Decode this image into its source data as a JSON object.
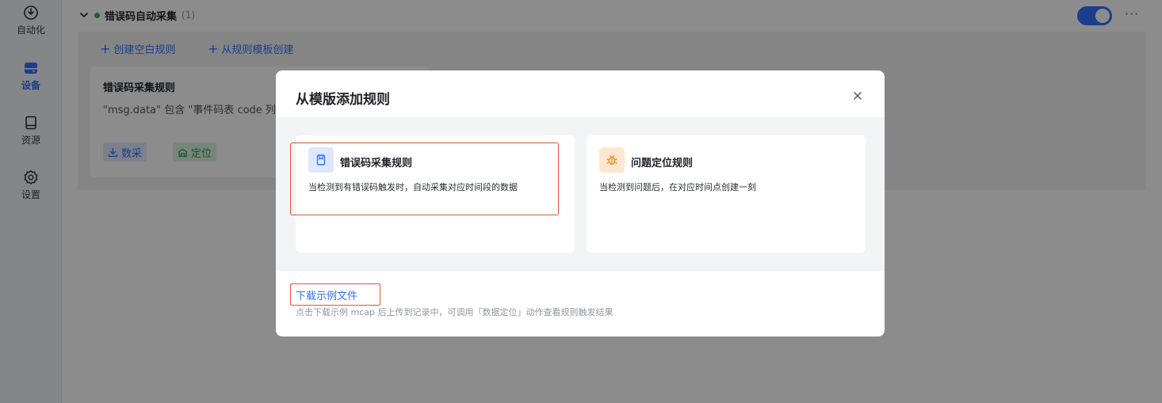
{
  "sidebar": {
    "items": [
      {
        "label": "自动化",
        "icon": "automation-icon",
        "active": false
      },
      {
        "label": "设备",
        "icon": "device-icon",
        "active": true
      },
      {
        "label": "资源",
        "icon": "resource-icon",
        "active": false
      },
      {
        "label": "设置",
        "icon": "settings-icon",
        "active": false
      }
    ]
  },
  "group": {
    "title": "错误码自动采集",
    "count": "(1)",
    "enabled": true,
    "more": "···"
  },
  "toolbar": {
    "create_blank": "创建空白规则",
    "create_from_template": "从规则模板创建"
  },
  "rule_card": {
    "title": "错误码采集规则",
    "description": "\"msg.data\" 包含 \"事件码表 code 列",
    "tags": [
      "数采",
      "定位"
    ]
  },
  "modal": {
    "title": "从模版添加规则",
    "templates": [
      {
        "title": "错误码采集规则",
        "description": "当检测到有错误码触发时，自动采集对应时间段的数据",
        "icon": "bookmark-icon",
        "accent": "#3370ff"
      },
      {
        "title": "问题定位规则",
        "description": "当检测到问题后，在对应时间点创建一刻",
        "icon": "bug-icon",
        "accent": "#f08a24"
      }
    ],
    "download_link": "下载示例文件",
    "download_hint": "点击下载示例 mcap 后上传到记录中，可调用「数据定位」动作查看规则触发结果"
  },
  "colors": {
    "accent": "#3370ff",
    "status_green": "#2fb45a",
    "highlight": "#e8512f"
  }
}
